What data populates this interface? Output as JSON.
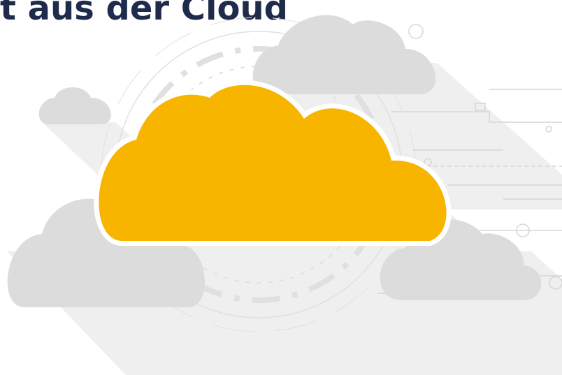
{
  "headline": {
    "text": "t aus der Cloud"
  },
  "artwork": {
    "clouds": [
      {
        "name": "main-cloud",
        "color": "#f7b500"
      },
      {
        "name": "small-cloud-left",
        "color": "#dcdcdc"
      },
      {
        "name": "cloud-top-right",
        "color": "#dcdcdc"
      },
      {
        "name": "cloud-bottom-left",
        "color": "#dcdcdc"
      },
      {
        "name": "cloud-bottom-right",
        "color": "#dcdcdc"
      }
    ],
    "shadow_color": "#eeeeee",
    "tech_ring_color": "#e4e4e4",
    "circuit_color": "#d8d8d8"
  }
}
